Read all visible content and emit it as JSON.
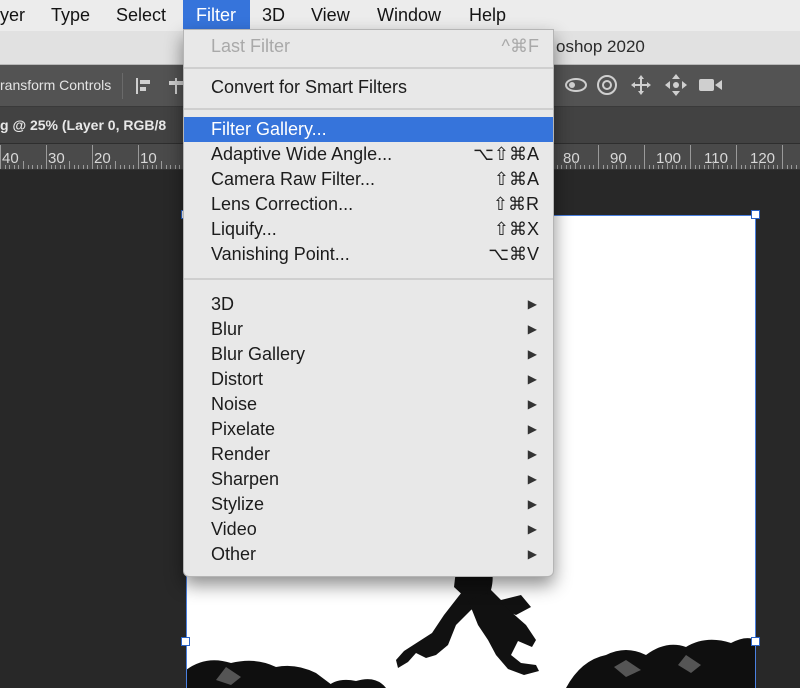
{
  "menubar": {
    "items": [
      {
        "label": "yer",
        "active": false
      },
      {
        "label": "Type",
        "active": false
      },
      {
        "label": "Select",
        "active": false
      },
      {
        "label": "Filter",
        "active": true
      },
      {
        "label": "3D",
        "active": false
      },
      {
        "label": "View",
        "active": false
      },
      {
        "label": "Window",
        "active": false
      },
      {
        "label": "Help",
        "active": false
      }
    ]
  },
  "window": {
    "title": "oshop 2020"
  },
  "options_bar": {
    "transform_label": "ransform Controls"
  },
  "document": {
    "tab_title": "g @ 25% (Layer 0, RGB/8"
  },
  "ruler": {
    "labels": [
      "40",
      "30",
      "20",
      "10",
      "80",
      "90",
      "100",
      "110",
      "120"
    ]
  },
  "filter_menu": {
    "last_filter": {
      "label": "Last Filter",
      "shortcut": "^⌘F",
      "disabled": true
    },
    "convert_smart": {
      "label": "Convert for Smart Filters"
    },
    "items": [
      {
        "label": "Filter Gallery...",
        "shortcut": "",
        "highlighted": true
      },
      {
        "label": "Adaptive Wide Angle...",
        "shortcut": "⌥⇧⌘A"
      },
      {
        "label": "Camera Raw Filter...",
        "shortcut": "⇧⌘A"
      },
      {
        "label": "Lens Correction...",
        "shortcut": "⇧⌘R"
      },
      {
        "label": "Liquify...",
        "shortcut": "⇧⌘X"
      },
      {
        "label": "Vanishing Point...",
        "shortcut": "⌥⌘V"
      }
    ],
    "submenus": [
      "3D",
      "Blur",
      "Blur Gallery",
      "Distort",
      "Noise",
      "Pixelate",
      "Render",
      "Sharpen",
      "Stylize",
      "Video",
      "Other"
    ],
    "submenu_arrow": "▶"
  },
  "colors": {
    "highlight": "#3674db",
    "menubar_bg": "#ececec",
    "workspace_bg": "#282828"
  }
}
